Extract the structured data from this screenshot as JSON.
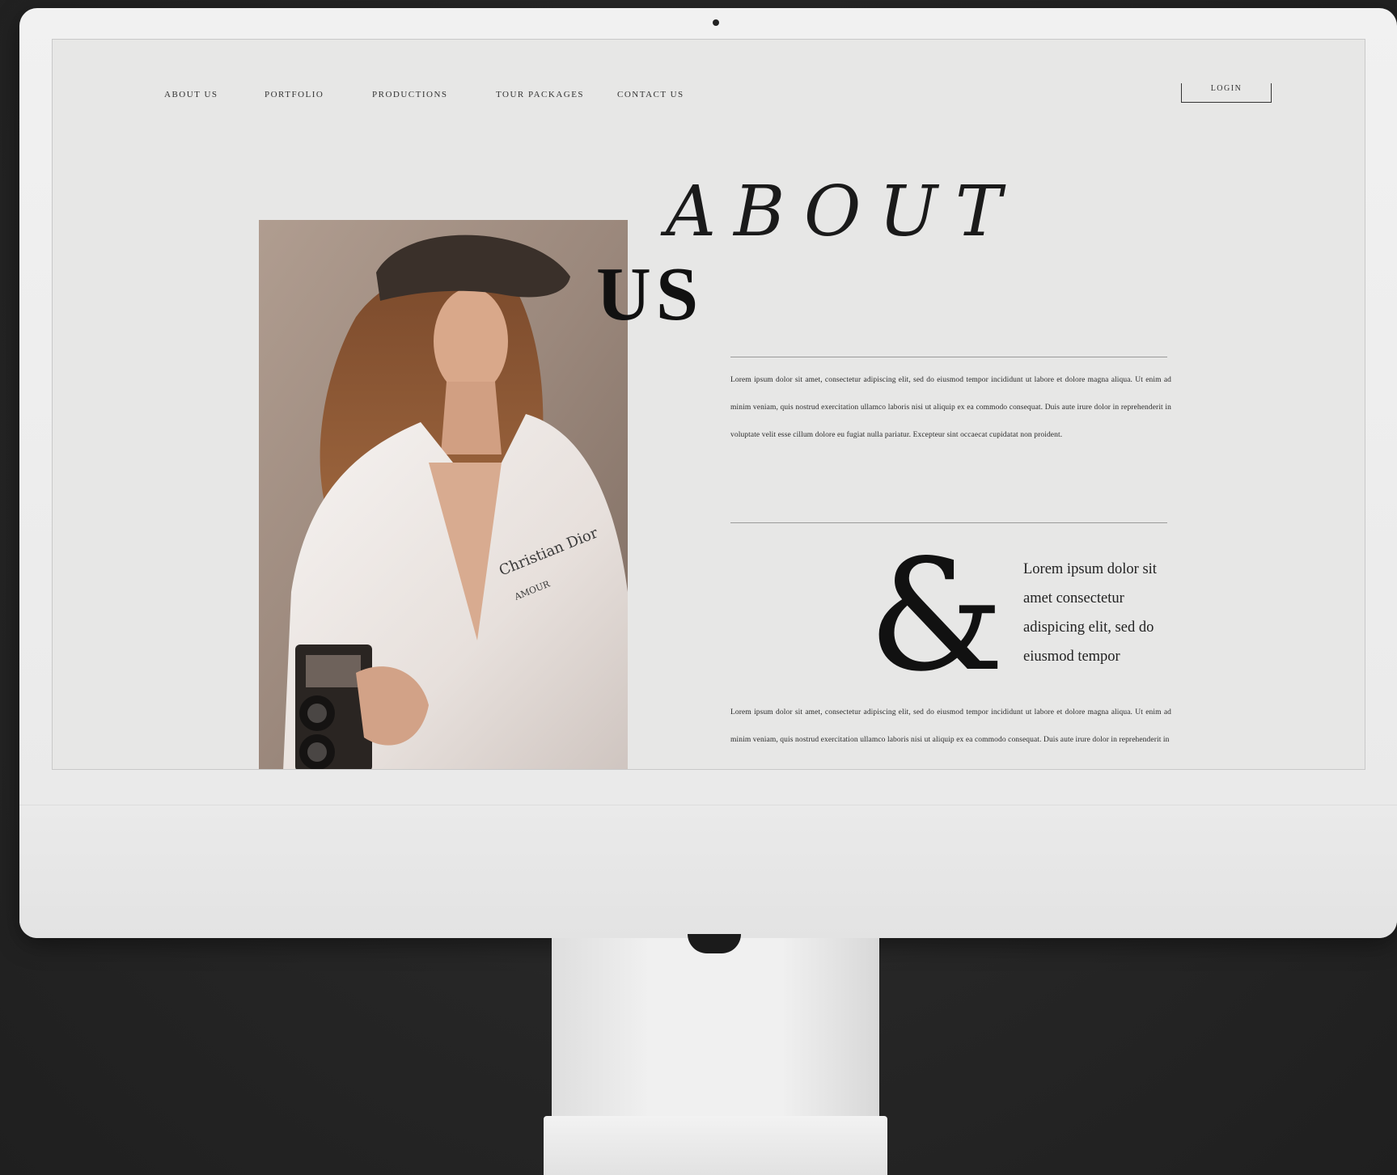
{
  "nav": {
    "items": [
      {
        "label": "ABOUT US"
      },
      {
        "label": "PORTFOLIO"
      },
      {
        "label": "PRODUCTIONS"
      },
      {
        "label": "TOUR PACKAGES"
      },
      {
        "label": "CONTACT US"
      }
    ],
    "login_label": "LOGIN"
  },
  "hero": {
    "heading_line1": "ABOUT",
    "heading_line2": "US"
  },
  "content": {
    "paragraph1": "Lorem ipsum dolor sit amet, consectetur adipiscing elit, sed do eiusmod tempor incididunt ut labore et dolore magna aliqua. Ut enim ad minim veniam, quis nostrud exercitation ullamco laboris nisi ut aliquip ex ea commodo consequat. Duis aute irure dolor in reprehenderit in voluptate velit esse cillum dolore eu fugiat nulla pariatur. Excepteur sint occaecat cupidatat non proident.",
    "ampersand": "&",
    "quote": "Lorem ipsum dolor sit amet consectetur adispicing elit, sed do eiusmod tempor",
    "paragraph2": "Lorem ipsum dolor sit amet, consectetur adipiscing elit, sed do eiusmod tempor incididunt ut labore et dolore magna aliqua. Ut enim ad minim veniam, quis nostrud exercitation ullamco laboris nisi ut aliquip ex ea commodo consequat. Duis aute irure dolor in reprehenderit in"
  },
  "photo": {
    "shirt_print_line1": "Christian Dior",
    "shirt_print_line2": "AMOUR"
  }
}
